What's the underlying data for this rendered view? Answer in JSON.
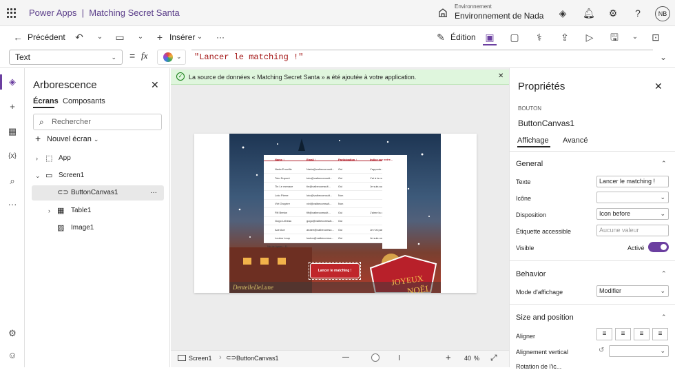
{
  "header": {
    "app": "Power Apps",
    "separator": "|",
    "project": "Matching Secret Santa",
    "env_small": "Environnement",
    "env_name": "Environnement de Nada",
    "avatar": "NB"
  },
  "toolbar": {
    "back": "Précédent",
    "insert": "Insérer",
    "more": "···",
    "edit": "Édition"
  },
  "formula": {
    "property": "Text",
    "equals": "=",
    "fx": "fx",
    "value": "\"Lancer le matching !\""
  },
  "tree": {
    "title": "Arborescence",
    "tab_screens": "Écrans",
    "tab_components": "Composants",
    "search_placeholder": "Rechercher",
    "new_screen": "Nouvel écran",
    "items": [
      "App",
      "Screen1",
      "ButtonCanvas1",
      "Table1",
      "Image1"
    ],
    "more": "···"
  },
  "banner": {
    "text": "La source de données « Matching Secret Santa » a été ajoutée à votre application."
  },
  "table": {
    "headers": [
      "Name ↑",
      "Email ↑",
      "Participation ↑",
      "Indice sur votre..."
    ],
    "rows": [
      [
        "Nada Enoville",
        "Nada@vaibecomsult...",
        "Oui",
        "J'apporte des choc..."
      ],
      [
        "Toto Dupont",
        "toto@vaibecomsult...",
        "Oui",
        "J'ai à la même barbe..."
      ],
      [
        "Tin Le menace",
        "tin@vaibecomsult...",
        "Oui",
        "Je suis auqui une..."
      ],
      [
        "Loto Pierre",
        "loto@vaibecomsult...",
        "Non",
        ""
      ],
      [
        "Vivi Gruyère",
        "vivi@vaibecomsult...",
        "Non",
        ""
      ],
      [
        "Fifi Breton",
        "fifi@vaibecomsult...",
        "Oui",
        "J'aime la couleur j..."
      ],
      [
        "Gogo Lebeau",
        "gogo@vaibecomsult...",
        "Oui",
        ""
      ],
      [
        "Ace Ace",
        "aeaee@vaibecomsu...",
        "Oui",
        "Je n'ai pas d'idée"
      ],
      [
        "Loulou Loup",
        "loulou@vaibecomsu...",
        "Oui",
        "Je suis un loup"
      ]
    ],
    "footer": "Nb de lignes : 11"
  },
  "canvas": {
    "button": "Lancer le matching !",
    "greeting_line1": "JOYEUX",
    "greeting_line2": "NOËL",
    "watermark": "DentelleDeLune"
  },
  "status": {
    "screen": "Screen1",
    "control": "ButtonCanvas1",
    "zoom": "40",
    "zoom_unit": "%",
    "minus": "—",
    "plus": "+"
  },
  "props": {
    "title": "Propriétés",
    "type": "BOUTON",
    "name": "ButtonCanvas1",
    "tab_display": "Affichage",
    "tab_advanced": "Avancé",
    "general": "General",
    "texte_label": "Texte",
    "texte_value": "Lancer le matching !",
    "icone_label": "Icône",
    "disposition_label": "Disposition",
    "disposition_value": "Icon before",
    "etiquette_label": "Étiquette accessible",
    "etiquette_placeholder": "Aucune valeur",
    "visible_label": "Visible",
    "visible_value": "Activé",
    "behavior": "Behavior",
    "mode_label": "Mode d'affichage",
    "mode_value": "Modifier",
    "size": "Size and position",
    "align_label": "Aligner",
    "valign_label": "Alignement vertical",
    "rotation_label": "Rotation de l'ic..."
  }
}
